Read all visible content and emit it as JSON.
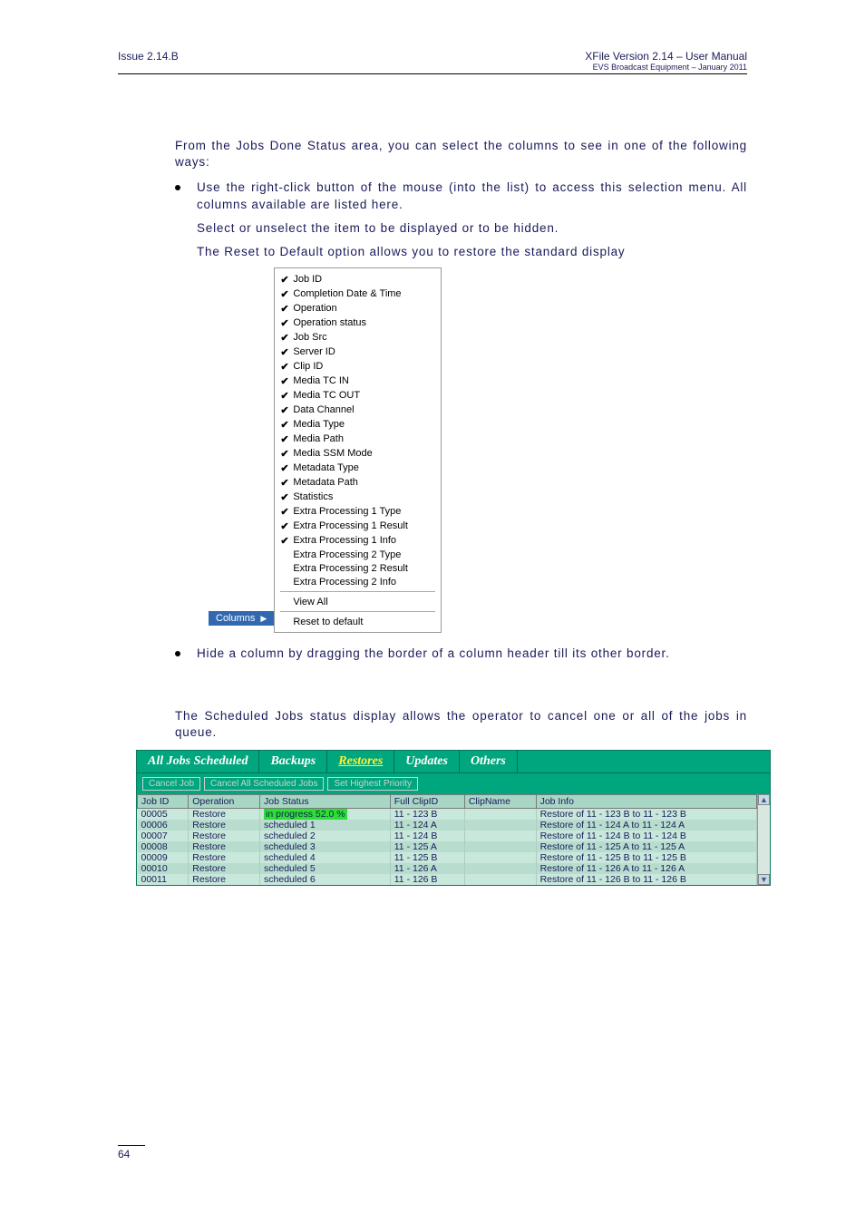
{
  "header": {
    "issue": "Issue 2.14.B",
    "title": "XFile Version 2.14 – User Manual",
    "subtitle": "EVS Broadcast Equipment – January 2011"
  },
  "intro": "From the Jobs Done Status area, you can select the columns to see in one of the following ways:",
  "bullet1": "Use the right-click button of the mouse (into the list) to access this selection menu. All columns available are listed here.",
  "sel_line": "Select or unselect the item to be displayed or to be hidden.",
  "reset_line": "The Reset to Default option allows you to restore the standard display",
  "columns_label": "Columns",
  "ctx_items": [
    {
      "c": true,
      "t": "Job ID"
    },
    {
      "c": true,
      "t": "Completion Date & Time"
    },
    {
      "c": true,
      "t": "Operation"
    },
    {
      "c": true,
      "t": "Operation status"
    },
    {
      "c": true,
      "t": "Job Src"
    },
    {
      "c": true,
      "t": "Server ID"
    },
    {
      "c": true,
      "t": "Clip ID"
    },
    {
      "c": true,
      "t": "Media TC IN"
    },
    {
      "c": true,
      "t": "Media TC OUT"
    },
    {
      "c": true,
      "t": "Data Channel"
    },
    {
      "c": true,
      "t": "Media Type"
    },
    {
      "c": true,
      "t": "Media Path"
    },
    {
      "c": true,
      "t": "Media SSM Mode"
    },
    {
      "c": true,
      "t": "Metadata Type"
    },
    {
      "c": true,
      "t": "Metadata Path"
    },
    {
      "c": true,
      "t": "Statistics"
    },
    {
      "c": true,
      "t": "Extra Processing 1 Type"
    },
    {
      "c": true,
      "t": "Extra Processing 1 Result"
    },
    {
      "c": true,
      "t": "Extra Processing 1 Info"
    },
    {
      "c": false,
      "t": "Extra Processing 2 Type"
    },
    {
      "c": false,
      "t": "Extra Processing 2 Result"
    },
    {
      "c": false,
      "t": "Extra Processing 2 Info"
    }
  ],
  "ctx_viewall": "View All",
  "ctx_reset": "Reset to default",
  "bullet2": "Hide a column by dragging the border of a column header till its other border.",
  "sched_intro": "The Scheduled Jobs status display allows the operator to cancel one or all of the jobs in queue.",
  "tabs": [
    "All Jobs Scheduled",
    "Backups",
    "Restores",
    "Updates",
    "Others"
  ],
  "toolbar_buttons": [
    "Cancel Job",
    "Cancel All Scheduled Jobs",
    "Set Highest Priority"
  ],
  "table": {
    "headers": [
      "Job ID",
      "Operation",
      "Job Status",
      "Full ClipID",
      "ClipName",
      "Job Info"
    ],
    "rows": [
      {
        "id": "00005",
        "op": "Restore",
        "status": "in progress 52.0 %",
        "clip": "11 - 123 B",
        "name": "",
        "info": "Restore of 11 - 123 B to 11 - 123 B",
        "prog": true
      },
      {
        "id": "00006",
        "op": "Restore",
        "status": "scheduled 1",
        "clip": "11 - 124 A",
        "name": "",
        "info": "Restore of 11 - 124 A to 11 - 124 A",
        "prog": false
      },
      {
        "id": "00007",
        "op": "Restore",
        "status": "scheduled 2",
        "clip": "11 - 124 B",
        "name": "",
        "info": "Restore of 11 - 124 B to 11 - 124 B",
        "prog": false
      },
      {
        "id": "00008",
        "op": "Restore",
        "status": "scheduled 3",
        "clip": "11 - 125 A",
        "name": "",
        "info": "Restore of 11 - 125 A to 11 - 125 A",
        "prog": false
      },
      {
        "id": "00009",
        "op": "Restore",
        "status": "scheduled 4",
        "clip": "11 - 125 B",
        "name": "",
        "info": "Restore of 11 - 125 B to 11 - 125 B",
        "prog": false
      },
      {
        "id": "00010",
        "op": "Restore",
        "status": "scheduled 5",
        "clip": "11 - 126 A",
        "name": "",
        "info": "Restore of 11 - 126 A to 11 - 126 A",
        "prog": false
      },
      {
        "id": "00011",
        "op": "Restore",
        "status": "scheduled 6",
        "clip": "11 - 126 B",
        "name": "",
        "info": "Restore of 11 - 126 B to 11 - 126 B",
        "prog": false
      }
    ]
  },
  "page_num": "64"
}
